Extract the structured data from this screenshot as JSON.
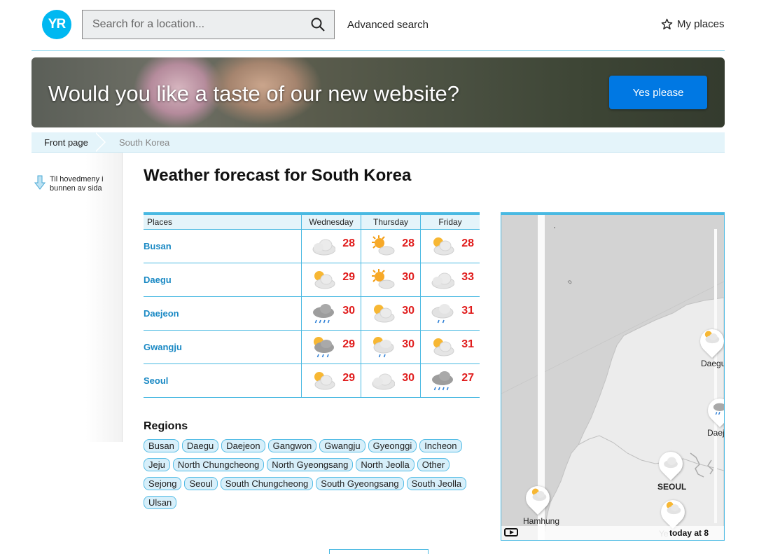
{
  "header": {
    "logo": "YR",
    "search_placeholder": "Search for a location...",
    "advanced_search": "Advanced search",
    "my_places": "My places"
  },
  "banner": {
    "text": "Would you like a taste of our new website?",
    "button": "Yes please"
  },
  "breadcrumb": {
    "front": "Front page",
    "current": "South Korea"
  },
  "sidebar": {
    "jump_line1": "Til hovedmeny i",
    "jump_line2": "bunnen av sida"
  },
  "title": "Weather forecast for South Korea",
  "table": {
    "headers": [
      "Places",
      "Wednesday",
      "Thursday",
      "Friday"
    ],
    "rows": [
      {
        "place": "Busan",
        "days": [
          {
            "icon": "cloud-icon",
            "temp": "28"
          },
          {
            "icon": "sun-cloud-icon",
            "temp": "28"
          },
          {
            "icon": "partly-cloudy-icon",
            "temp": "28"
          }
        ]
      },
      {
        "place": "Daegu",
        "days": [
          {
            "icon": "partly-cloudy-icon",
            "temp": "29"
          },
          {
            "icon": "sun-cloud-icon",
            "temp": "30"
          },
          {
            "icon": "cloud-icon",
            "temp": "33"
          }
        ]
      },
      {
        "place": "Daejeon",
        "days": [
          {
            "icon": "rain-cloud-icon",
            "temp": "30"
          },
          {
            "icon": "partly-cloudy-icon",
            "temp": "30"
          },
          {
            "icon": "light-rain-icon",
            "temp": "31"
          }
        ]
      },
      {
        "place": "Gwangju",
        "days": [
          {
            "icon": "sun-rain-icon",
            "temp": "29"
          },
          {
            "icon": "sun-light-rain-icon",
            "temp": "30"
          },
          {
            "icon": "partly-cloudy-icon",
            "temp": "31"
          }
        ]
      },
      {
        "place": "Seoul",
        "days": [
          {
            "icon": "partly-cloudy-icon",
            "temp": "29"
          },
          {
            "icon": "cloud-icon",
            "temp": "30"
          },
          {
            "icon": "rain-cloud-icon",
            "temp": "27"
          }
        ]
      }
    ]
  },
  "regions": {
    "title": "Regions",
    "rows": [
      [
        "Busan",
        "Daegu",
        "Daejeon",
        "Gangwon",
        "Gwangju",
        "Gyeonggi",
        "Incheon"
      ],
      [
        "Jeju",
        "North Chungcheong",
        "North Gyeongsang",
        "North Jeolla",
        "Other"
      ],
      [
        "Sejong",
        "Seoul",
        "South Chungcheong",
        "South Gyeongsang",
        "South Jeolla"
      ],
      [
        "Ulsan"
      ]
    ]
  },
  "map": {
    "labels": {
      "hamhung": "Hamhung",
      "seoul": "SEOUL",
      "daegu": "Daegu",
      "daej": "Daej",
      "ye": "Ye"
    },
    "time": "today at 8"
  }
}
